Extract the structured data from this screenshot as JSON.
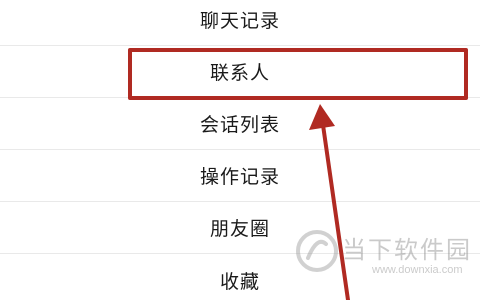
{
  "menu": {
    "items": [
      {
        "label": "聊天记录"
      },
      {
        "label": "联系人"
      },
      {
        "label": "会话列表"
      },
      {
        "label": "操作记录"
      },
      {
        "label": "朋友圈"
      },
      {
        "label": "收藏"
      }
    ]
  },
  "annotation": {
    "highlight_color": "#b02a22",
    "arrow_color": "#b02a22"
  },
  "watermark": {
    "name": "当下软件园",
    "url": "www.downxia.com"
  }
}
